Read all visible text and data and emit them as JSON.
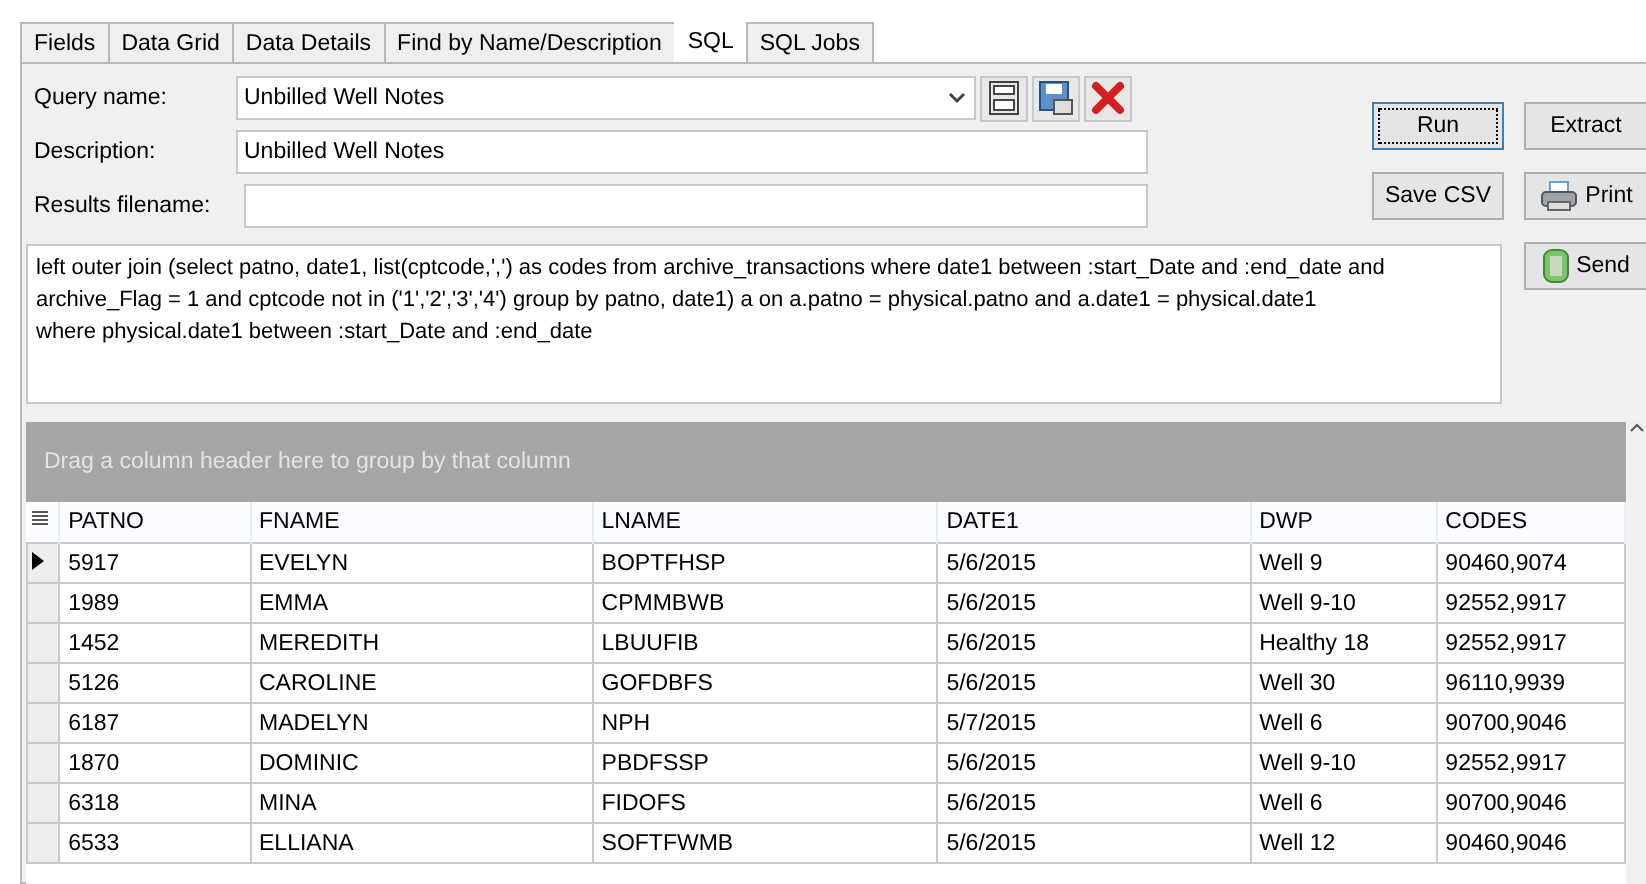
{
  "tabs": [
    {
      "label": "Fields",
      "selected": false
    },
    {
      "label": "Data Grid",
      "selected": false
    },
    {
      "label": "Data Details",
      "selected": false
    },
    {
      "label": "Find by Name/Description",
      "selected": false
    },
    {
      "label": "SQL",
      "selected": true
    },
    {
      "label": "SQL Jobs",
      "selected": false
    }
  ],
  "form": {
    "query_name_label": "Query name:",
    "query_name": "Unbilled Well Notes",
    "description_label": "Description:",
    "description": "Unbilled Well Notes",
    "results_filename_label": "Results filename:",
    "sql": "left outer join (select patno, date1, list(cptcode,',') as codes from archive_transactions where date1 between :start_Date and :end_date and archive_Flag = 1 and cptcode not in ('1','2','3','4') group by patno, date1) a on a.patno = physical.patno and a.date1 = physical.date1\nwhere physical.date1 between :start_Date and :end_date"
  },
  "buttons": [
    {
      "label": "Run",
      "kind": "plain",
      "focused": true
    },
    {
      "label": "Extract",
      "kind": "plain",
      "focused": false
    },
    {
      "label": "Save CSV",
      "kind": "plain",
      "focused": false
    },
    {
      "label": "Print",
      "kind": "print",
      "focused": false
    },
    {
      "label": "Send",
      "kind": "send",
      "focused": false
    }
  ],
  "grid": {
    "group_hint": "Drag a column header here to group by that column",
    "columns": [
      "PATNO",
      "FNAME",
      "LNAME",
      "DATE1",
      "DWP",
      "CODES"
    ],
    "rows": [
      {
        "selected": true,
        "cells": [
          "5917",
          "EVELYN",
          "BOPTFHSP",
          "5/6/2015",
          "Well 9",
          "90460,9074"
        ]
      },
      {
        "selected": false,
        "cells": [
          "1989",
          "EMMA",
          "CPMMBWB",
          "5/6/2015",
          "Well 9-10",
          "92552,9917"
        ]
      },
      {
        "selected": false,
        "cells": [
          "1452",
          "MEREDITH",
          "LBUUFIB",
          "5/6/2015",
          "Healthy 18",
          "92552,9917"
        ]
      },
      {
        "selected": false,
        "cells": [
          "5126",
          "CAROLINE",
          "GOFDBFS",
          "5/6/2015",
          "Well 30",
          "96110,9939"
        ]
      },
      {
        "selected": false,
        "cells": [
          "6187",
          "MADELYN",
          "NPH",
          "5/7/2015",
          "Well 6",
          "90700,9046"
        ]
      },
      {
        "selected": false,
        "cells": [
          "1870",
          "DOMINIC",
          "PBDFSSP",
          "5/6/2015",
          "Well 9-10",
          "92552,9917"
        ]
      },
      {
        "selected": false,
        "cells": [
          "6318",
          "MINA",
          "FIDOFS",
          "5/6/2015",
          "Well 6",
          "90700,9046"
        ]
      },
      {
        "selected": false,
        "cells": [
          "6533",
          "ELLIANA",
          "SOFTFWMB",
          "5/6/2015",
          "Well 12",
          "90460,9046"
        ]
      }
    ]
  }
}
